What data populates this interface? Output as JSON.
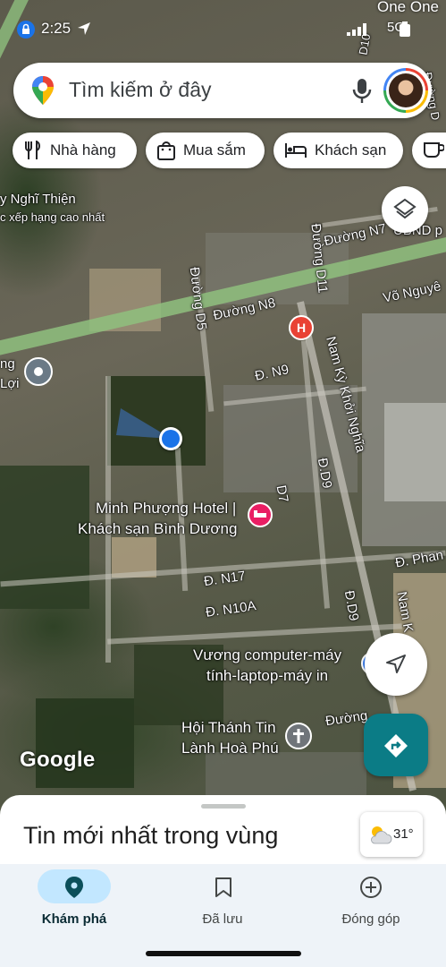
{
  "status_bar": {
    "time": "2:25",
    "carrier": "One One",
    "network": "5G"
  },
  "search": {
    "placeholder": "Tìm kiếm ở đây"
  },
  "chips": [
    "Nhà hàng",
    "Mua sắm",
    "Khách sạn"
  ],
  "map": {
    "labels": {
      "place_top_left": "y Nghĩ Thiện",
      "place_top_left_sub": "c xếp hạng cao nhất",
      "left_poi_1": "ng",
      "left_poi_2": "Lợi",
      "duong_n7": "Đường N7",
      "ubnd": "UBND p",
      "duong_d11": "Đường D11",
      "duong_d5": "Đường D5",
      "duong_n8": "Đường N8",
      "vo_nguyen": "Võ Nguyê",
      "d_n9": "Đ. N9",
      "nam_ky": "Nam Kỳ Khởi Nghĩa",
      "d_d9": "Đ.D9",
      "d7": "D7",
      "hotel_1": "Minh Phượng Hotel |",
      "hotel_2": "Khách sạn Bình Dương",
      "d_n17": "Đ. N17",
      "d_n10a": "Đ. N10A",
      "d_phan": "Đ. Phan",
      "d_d9b": "Đ.D9",
      "nam_right": "Nam K",
      "vuong_1": "Vương computer-máy",
      "vuong_2": "tính-laptop-máy in",
      "church_1": "Hội Thánh Tin",
      "church_2": "Lành Hoà Phú",
      "duong_bottom": "Đường",
      "d10": "D10",
      "duong_right_top": "Đường D"
    },
    "attribution": "Google"
  },
  "sheet": {
    "title": "Tin mới nhất trong vùng",
    "weather": "31°"
  },
  "nav": {
    "items": [
      "Khám phá",
      "Đã lưu",
      "Đóng góp"
    ],
    "active": 0
  },
  "colors": {
    "accent": "#0b7c86",
    "blue_dot": "#1a73e8",
    "hotel": "#e91e63",
    "hospital": "#e94235"
  }
}
